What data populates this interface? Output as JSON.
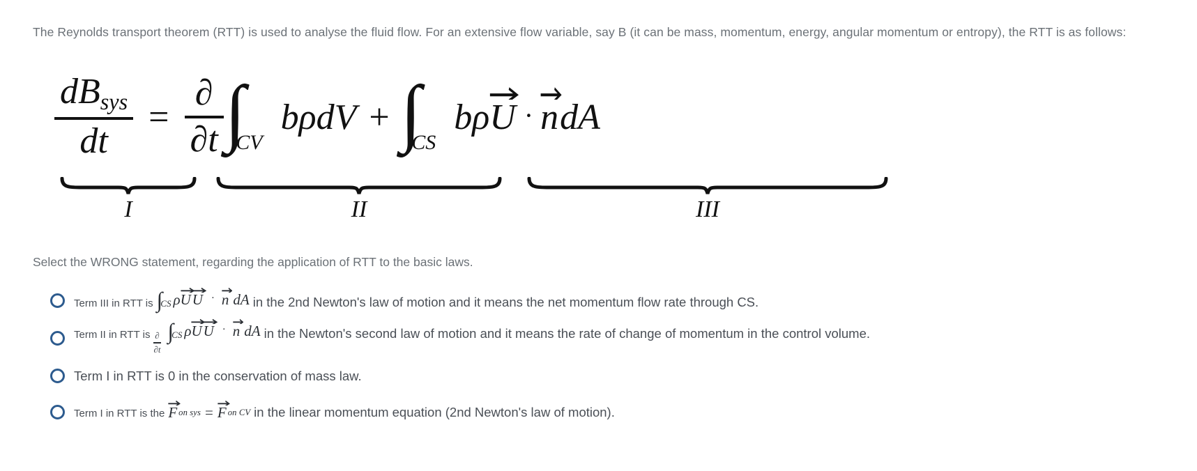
{
  "intro": "The Reynolds transport theorem (RTT) is used to analyse the fluid flow. For an extensive flow variable,  say B (it can be mass, momentum, energy, angular momentum or entropy), the RTT  is as follows:",
  "equation": {
    "lhs": {
      "numerator_d": "d",
      "numerator_B": "B",
      "numerator_sub": "sys",
      "denominator": "dt"
    },
    "equals": "=",
    "term2": {
      "partial_num": "∂",
      "partial_den": "∂t",
      "integral": "∫",
      "limit": "CV",
      "integrand_b": "b",
      "integrand_rho": "ρ",
      "integrand_dV": "dV"
    },
    "plus": "+",
    "term3": {
      "integral": "∫",
      "limit": "CS",
      "integrand_b": "b",
      "integrand_rho": "ρ",
      "vector_U": "U",
      "dot": "·",
      "vector_n": "n",
      "dA": "dA"
    },
    "brace_labels": [
      "I",
      "II",
      "III"
    ]
  },
  "question": "Select the WRONG statement,  regarding the application of RTT to the basic laws.",
  "options": [
    {
      "lead": "Term III in RTT is",
      "math": {
        "integral": "∫",
        "limit": "CS",
        "rho": "ρ",
        "vec1": "U",
        "vec2": "U",
        "dot": "·",
        "vecn": "n",
        "dA": "dA"
      },
      "tail": "in the 2nd Newton's law of motion and it means the net momentum flow rate through CS.",
      "has_partial_fraction": false,
      "style": "math"
    },
    {
      "lead": "Term II in RTT is",
      "math": {
        "frac_num": "∂",
        "frac_den": "∂t",
        "integral": "∫",
        "limit": "CS",
        "rho": "ρ",
        "vec1": "U",
        "vec2": "U",
        "dot": "·",
        "vecn": "n",
        "dA": "dA"
      },
      "tail": "in the Newton's second law of motion  and it means the rate of change of momentum in the control volume.",
      "has_partial_fraction": true,
      "style": "math"
    },
    {
      "lead": "Term I in RTT is 0 in the conservation of mass law.",
      "tail": "",
      "style": "plain"
    },
    {
      "lead": "Term I in RTT  is the",
      "math": {
        "vecF1": "F",
        "sub1": "on sys",
        "equals": "=",
        "vecF2": "F",
        "sub2": "on CV"
      },
      "tail": "in the linear momentum equation (2nd Newton's law of motion).",
      "style": "math-force"
    }
  ],
  "colors": {
    "radio_blue": "#2d5b8e",
    "body_text": "#4a4f56",
    "muted_text": "#6b7177",
    "math_black": "#111111"
  }
}
